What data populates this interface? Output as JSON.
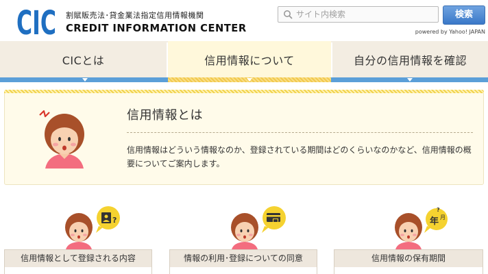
{
  "header": {
    "logo_text": "CIC",
    "tagline": "割賦販売法･貸金業法指定信用情報機関",
    "brand": "CREDIT INFORMATION CENTER",
    "search_placeholder": "サイト内検索",
    "search_button": "検索",
    "powered_by": "powered by Yahoo! JAPAN"
  },
  "nav": {
    "tabs": [
      {
        "label": "CICとは"
      },
      {
        "label": "信用情報について",
        "active": true
      },
      {
        "label": "自分の信用情報を確認"
      }
    ]
  },
  "intro": {
    "title": "信用情報とは",
    "text": "信用情報はどういう情報なのか、登録されている期間はどのくらいなのかなど、信用情報の概要についてご案内します。"
  },
  "cards": [
    {
      "title": "信用情報として登録される内容",
      "bubble_icon": "id-card-icon"
    },
    {
      "title": "情報の利用･登録についての同意",
      "bubble_icon": "credit-card-lock-icon"
    },
    {
      "title": "信用情報の保有期間",
      "bubble_icon": "year-month-icon",
      "bubble_text": "年",
      "bubble_sub": "月"
    }
  ],
  "colors": {
    "logo_blue": "#1f6fc1",
    "nav_bg": "#f3ede2",
    "nav_active_bg": "#fff8db",
    "nav_bar": "#5b9fd8",
    "accent_yellow": "#f1d34e",
    "intro_bg": "#fffbea"
  }
}
